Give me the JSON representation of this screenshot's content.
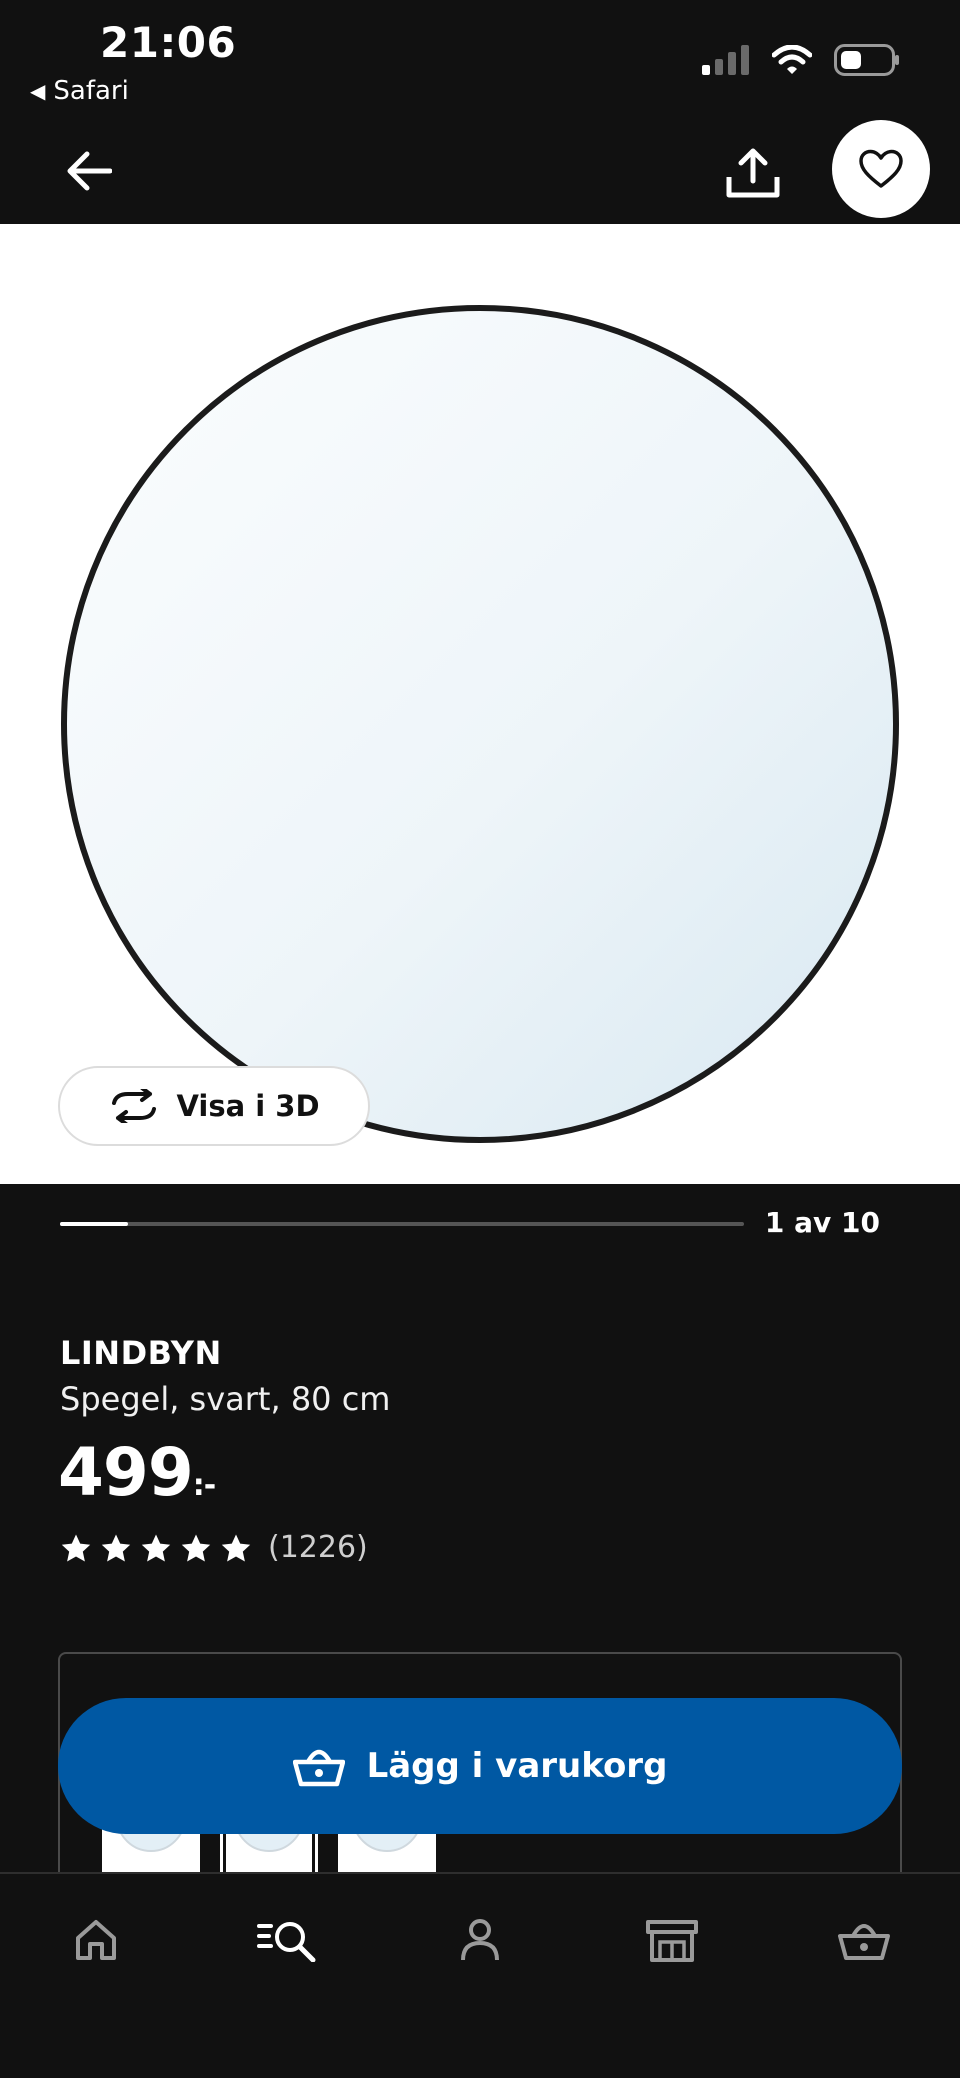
{
  "status_bar": {
    "time": "21:06",
    "back_app": "Safari",
    "back_icon": "triangle-left-icon",
    "signal_icon": "cellular-signal-icon",
    "wifi_icon": "wifi-icon",
    "battery_icon": "battery-icon"
  },
  "header": {
    "back_icon": "arrow-left-icon",
    "share_icon": "share-icon",
    "favorite_icon": "heart-icon"
  },
  "gallery": {
    "view_3d_label": "Visa i 3D",
    "view_3d_icon": "rotate-3d-icon",
    "counter": "1 av 10",
    "current_image": 1,
    "total_images": 10
  },
  "product": {
    "name": "LINDBYN",
    "description": "Spegel, svart, 80 cm",
    "price": "499",
    "price_suffix": ":-",
    "rating_stars": 5,
    "review_count": "(1226)"
  },
  "purchase": {
    "add_to_cart_label": "Lägg i varukorg",
    "cart_icon": "basket-icon",
    "variants": [
      "variant-1",
      "variant-2",
      "variant-3"
    ]
  },
  "bottom_nav": {
    "items": [
      {
        "icon": "home-icon"
      },
      {
        "icon": "search-icon"
      },
      {
        "icon": "profile-icon"
      },
      {
        "icon": "store-icon"
      },
      {
        "icon": "basket-icon"
      }
    ]
  },
  "colors": {
    "background": "#111111",
    "accent_blue": "#0058a3",
    "text": "#ffffff"
  }
}
